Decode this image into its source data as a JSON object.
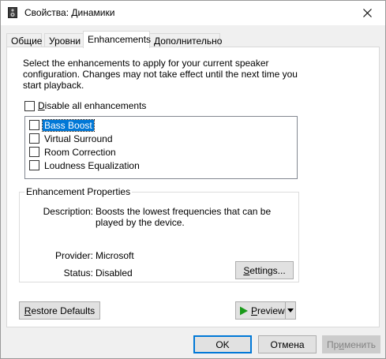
{
  "window": {
    "title": "Свойства: Динамики"
  },
  "tabs": [
    {
      "label": "Общие"
    },
    {
      "label": "Уровни"
    },
    {
      "label": "Enhancements"
    },
    {
      "label": "Дополнительно"
    }
  ],
  "enhancements": {
    "description": "Select the enhancements to apply for your current speaker configuration. Changes may not take effect until the next time you start playback.",
    "disable_all": {
      "first": "D",
      "rest": "isable all enhancements",
      "checked": false
    },
    "items": [
      {
        "label": "Bass Boost",
        "checked": false,
        "selected": true
      },
      {
        "label": "Virtual Surround",
        "checked": false,
        "selected": false
      },
      {
        "label": "Room Correction",
        "checked": false,
        "selected": false
      },
      {
        "label": "Loudness Equalization",
        "checked": false,
        "selected": false
      }
    ]
  },
  "properties": {
    "title": "Enhancement Properties",
    "description_label": "Description:",
    "description_value": "Boosts the lowest frequencies that can be played by the device.",
    "provider_label": "Provider:",
    "provider_value": "Microsoft",
    "status_label": "Status:",
    "status_value": "Disabled",
    "settings_first": "S",
    "settings_rest": "ettings..."
  },
  "buttons": {
    "restore_first": "R",
    "restore_rest": "estore Defaults",
    "preview_first": "P",
    "preview_rest": "review",
    "ok": "OK",
    "cancel": "Отмена",
    "apply_a": "Пр",
    "apply_u": "и",
    "apply_b": "менить"
  },
  "colors": {
    "accent": "#0078d7",
    "play": "#1a9a1a"
  }
}
